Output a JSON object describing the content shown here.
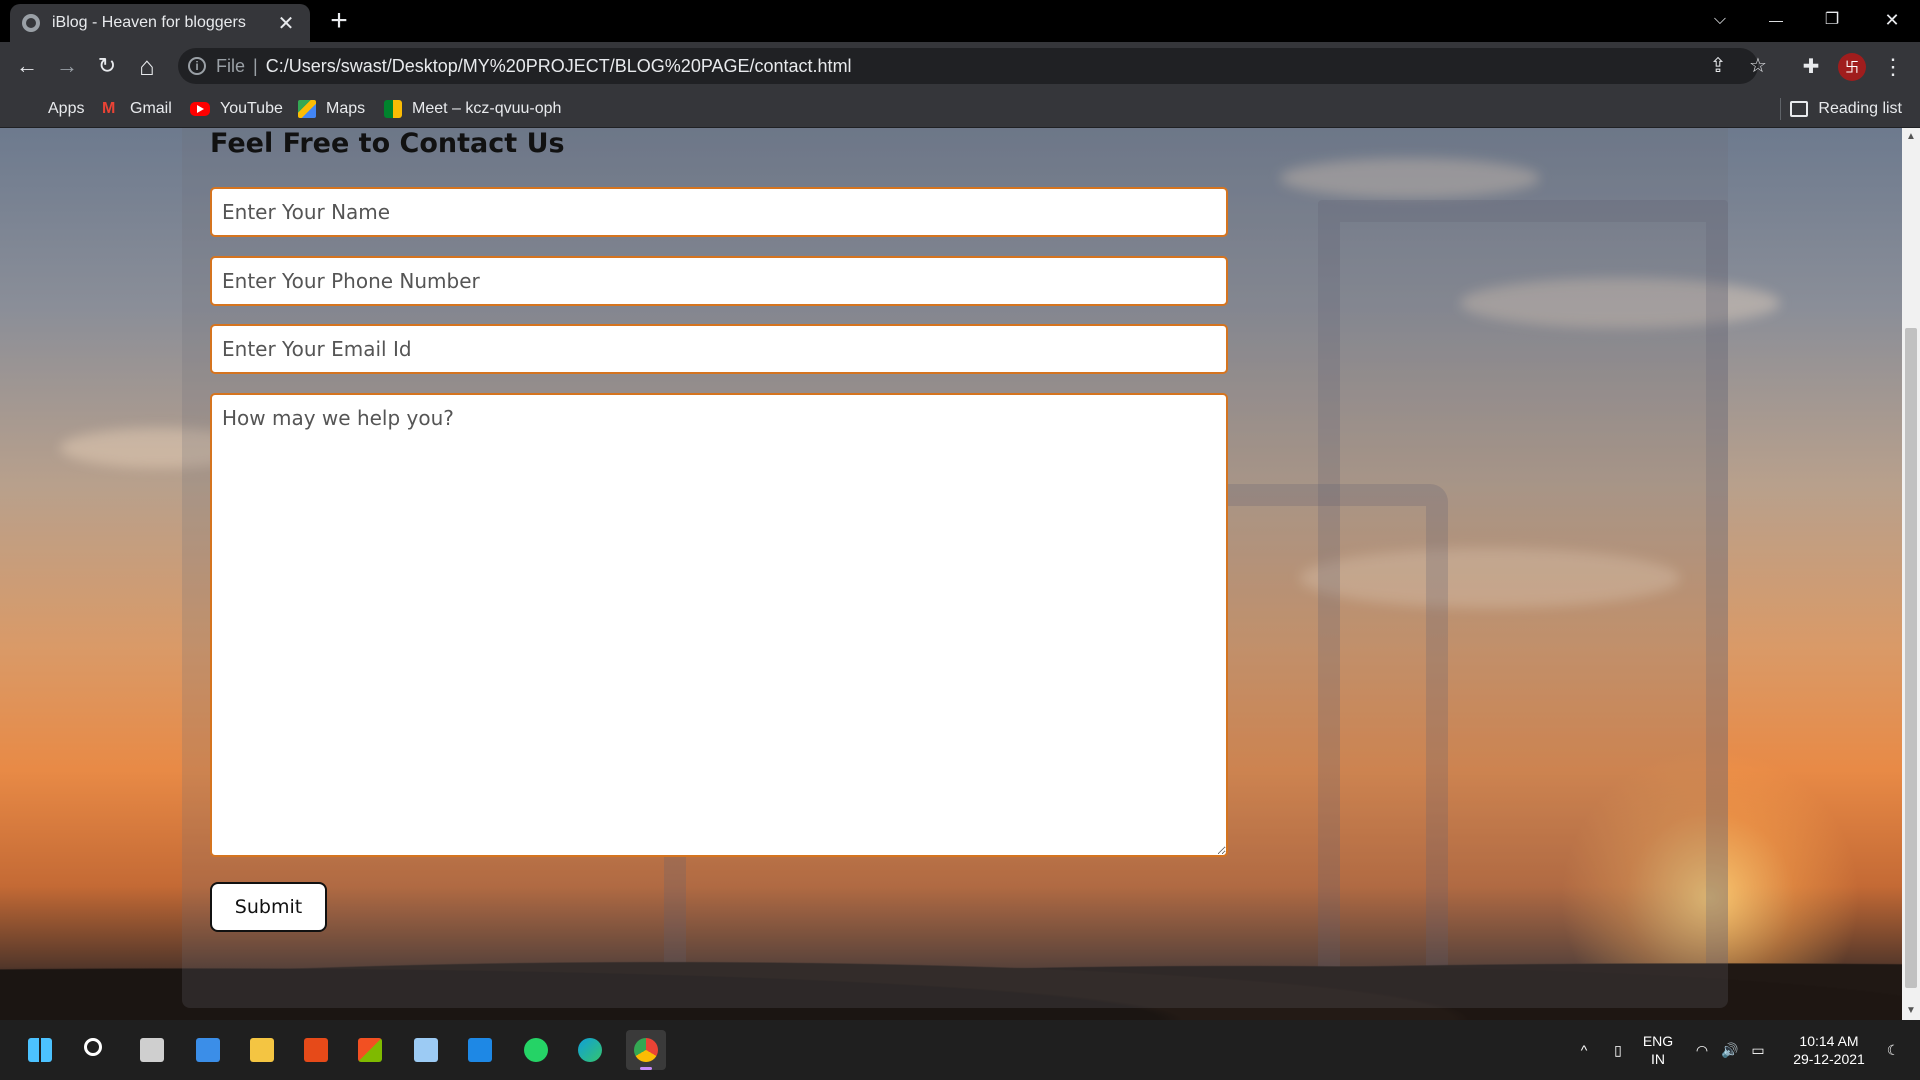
{
  "browser": {
    "tab_title": "iBlog - Heaven for bloggers",
    "tab_close": "✕",
    "new_tab": "+",
    "window_controls": {
      "tabsearch": "⌵",
      "minimize": "—",
      "restore": "❐",
      "close": "✕"
    },
    "nav": {
      "back": "←",
      "forward": "→",
      "reload": "↻",
      "home": "⌂"
    },
    "address": {
      "scheme": "File",
      "separator": "|",
      "url": "C:/Users/swast/Desktop/MY%20PROJECT/BLOG%20PAGE/contact.html"
    },
    "profile_initial": "卐",
    "bookmarks": [
      {
        "label": "Apps",
        "icon": "apps-grid-icon"
      },
      {
        "label": "Gmail",
        "icon": "gmail-icon"
      },
      {
        "label": "YouTube",
        "icon": "youtube-icon"
      },
      {
        "label": "Maps",
        "icon": "maps-icon"
      },
      {
        "label": "Meet – kcz-qvuu-oph",
        "icon": "meet-icon"
      }
    ],
    "reading_list": "Reading list"
  },
  "page": {
    "heading": "Feel Free to Contact Us",
    "form": {
      "name_placeholder": "Enter Your Name",
      "phone_placeholder": "Enter Your Phone Number",
      "email_placeholder": "Enter Your Email Id",
      "message_placeholder": "How may we help you?",
      "submit_label": "Submit"
    }
  },
  "taskbar": {
    "language": {
      "line1": "ENG",
      "line2": "IN"
    },
    "time": "10:14 AM",
    "date": "29-12-2021",
    "tray_chevron": "^"
  },
  "colors": {
    "input_border": "#d5741f",
    "browser_frame": "#35363a",
    "taskbar": "#1f1f1f"
  }
}
